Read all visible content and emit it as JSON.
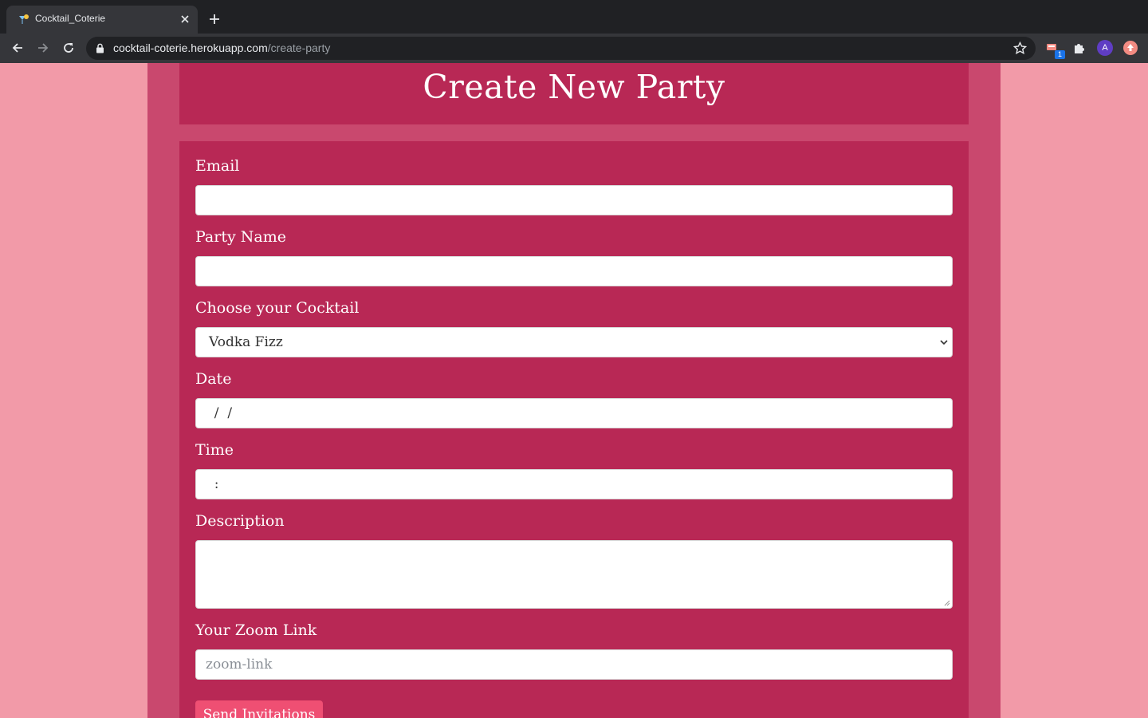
{
  "browser": {
    "tab_title": "Cocktail_Coterie",
    "url_host": "cocktail-coterie.herokuapp.com",
    "url_path": "/create-party",
    "avatar_letter": "A",
    "extension_badge": "1"
  },
  "page": {
    "title": "Create New Party",
    "form": {
      "email": {
        "label": "Email",
        "value": ""
      },
      "party_name": {
        "label": "Party Name",
        "value": ""
      },
      "cocktail": {
        "label": "Choose your Cocktail",
        "selected": "Vodka Fizz"
      },
      "date": {
        "label": "Date",
        "value": "  /  /"
      },
      "time": {
        "label": "Time",
        "value": "  :"
      },
      "description": {
        "label": "Description",
        "value": ""
      },
      "zoom_link": {
        "label": "Your Zoom Link",
        "placeholder": "zoom-link"
      },
      "submit_label": "Send Invitations"
    }
  },
  "colors": {
    "page_background": "#f29aa8",
    "container": "#c9486e",
    "card": "#b82855",
    "button": "#ef4f73"
  }
}
